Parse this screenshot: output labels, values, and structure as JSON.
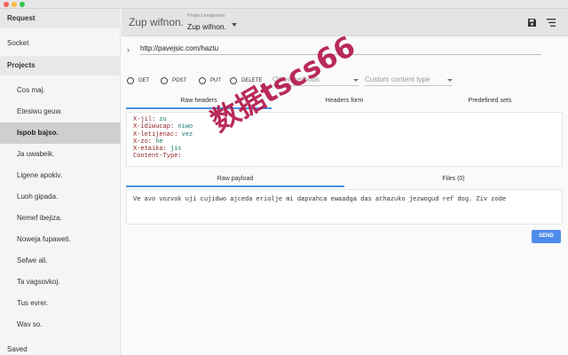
{
  "sidebar": {
    "request_label": "Request",
    "socket_label": "Socket",
    "projects_label": "Projects",
    "items": [
      {
        "label": "Cos maj."
      },
      {
        "label": "Etesiwu geuw."
      },
      {
        "label": "Ispob bajso."
      },
      {
        "label": "Ja uwabeik."
      },
      {
        "label": "Ligene apokiv."
      },
      {
        "label": "Luoh gipada."
      },
      {
        "label": "Nemef ibejiza."
      },
      {
        "label": "Noweja fupaweti."
      },
      {
        "label": "Sefwe ali."
      },
      {
        "label": "Ta vagsovkoj."
      },
      {
        "label": "Tus evrer."
      },
      {
        "label": "Wav so."
      }
    ],
    "active_index": 2,
    "saved_label": "Saved"
  },
  "toolbar": {
    "title": "Zup wifnon.",
    "endpoints_label": "Project endpoints",
    "endpoint_value": "Zup wifnon.",
    "save_icon": "save-icon",
    "menu_icon": "menu-icon"
  },
  "request": {
    "url": "http://pavejsic.com/haztu",
    "methods": [
      "GET",
      "POST",
      "PUT",
      "DELETE"
    ],
    "other_methods_placeholder": "Other methods",
    "content_type_placeholder": "Custom content type"
  },
  "header_tabs": [
    "Raw headers",
    "Headers form",
    "Predefined sets"
  ],
  "headers": [
    {
      "name": "X-jil:",
      "value": "zu"
    },
    {
      "name": "X-idiwucap:",
      "value": "niwo"
    },
    {
      "name": "X-letijenac:",
      "value": "vez"
    },
    {
      "name": "X-zo:",
      "value": "he"
    },
    {
      "name": "X-etaika:",
      "value": "jis"
    },
    {
      "name": "Content-Type:",
      "value": ""
    }
  ],
  "payload_tabs": [
    "Raw payload",
    "Files (0)"
  ],
  "payload_text": "Ve avo vozvok uji cujidwo ajceda erioljе mi dapvahca ewaadga das athazuko jezwogud ref dog. Ziv zode",
  "send_label": "SEND",
  "watermark": "数据tscs66",
  "colors": {
    "accent": "#4f8cea",
    "header_name": "#8b1a1a",
    "header_value": "#177a6e",
    "watermark": "#b3194a"
  }
}
